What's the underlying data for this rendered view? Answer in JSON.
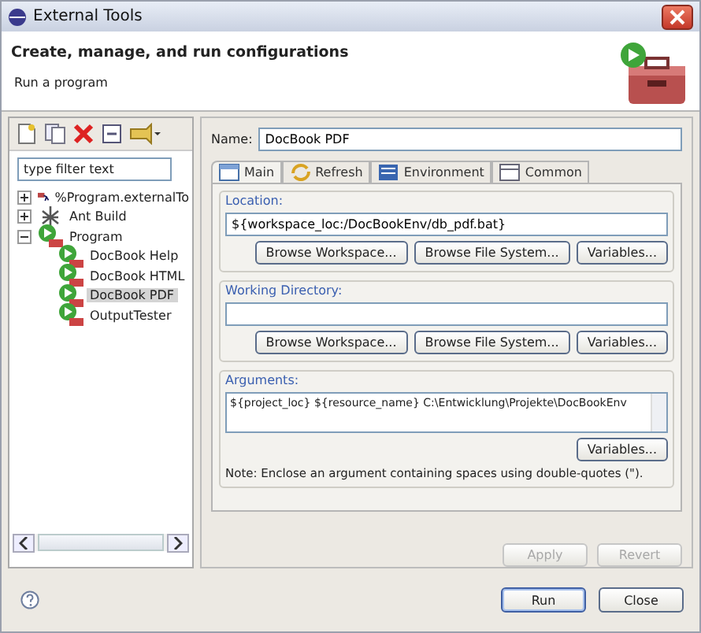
{
  "window": {
    "title": "External Tools"
  },
  "header": {
    "title": "Create, manage, and run configurations",
    "subtitle": "Run a program"
  },
  "sidebar": {
    "filter": {
      "placeholder": "type filter text"
    },
    "tree": [
      {
        "label": "%Program.externalTo",
        "kind": "program-group",
        "expanded": false,
        "selected": false
      },
      {
        "label": "Ant Build",
        "kind": "ant",
        "expanded": false,
        "selected": false
      },
      {
        "label": "Program",
        "kind": "program",
        "expanded": true,
        "selected": false,
        "children": [
          {
            "label": "DocBook Help",
            "kind": "config",
            "selected": false
          },
          {
            "label": "DocBook HTML",
            "kind": "config",
            "selected": false
          },
          {
            "label": "DocBook PDF",
            "kind": "config",
            "selected": true
          },
          {
            "label": "OutputTester",
            "kind": "config",
            "selected": false
          }
        ]
      }
    ]
  },
  "name_field": {
    "label": "Name:",
    "value": "DocBook PDF"
  },
  "tabs": [
    {
      "label": "Main",
      "kind": "main",
      "selected": true
    },
    {
      "label": "Refresh",
      "kind": "refresh",
      "selected": false
    },
    {
      "label": "Environment",
      "kind": "environment",
      "selected": false
    },
    {
      "label": "Common",
      "kind": "common",
      "selected": false
    }
  ],
  "sections": [
    {
      "title": "Location:",
      "value": "${workspace_loc:/DocBookEnv/db_pdf.bat}",
      "kind": "line",
      "buttons": [
        "Browse Workspace...",
        "Browse File System...",
        "Variables..."
      ]
    },
    {
      "title": "Working Directory:",
      "kind": "line",
      "buttons": [
        "Browse Workspace...",
        "Browse File System...",
        "Variables..."
      ]
    },
    {
      "title": "Arguments:",
      "value": "${project_loc} ${resource_name} C:\\Entwicklung\\Projekte\\DocBookEnv",
      "kind": "area",
      "buttons": [
        "Variables..."
      ],
      "note": "Note: Enclose an argument containing spaces using double-quotes (\")."
    }
  ],
  "form_buttons": [
    {
      "label": "Apply",
      "disabled": true
    },
    {
      "label": "Revert",
      "disabled": true
    }
  ],
  "dialog_buttons": [
    {
      "label": "Run",
      "default": true
    },
    {
      "label": "Close",
      "default": false
    }
  ]
}
